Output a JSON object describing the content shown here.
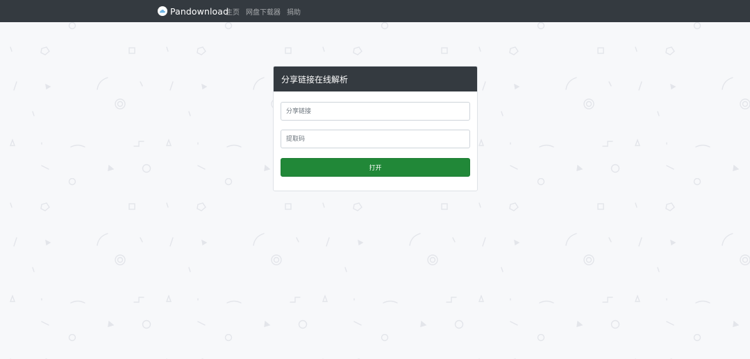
{
  "navbar": {
    "brand": "Pandownload",
    "brand_icon": "cloud-icon",
    "links": [
      "主页",
      "网盘下载器",
      "捐助"
    ]
  },
  "card": {
    "title": "分享链接在线解析",
    "link_placeholder": "分享链接",
    "code_placeholder": "提取码",
    "open_label": "打开"
  },
  "colors": {
    "navbar_bg": "#343a40",
    "page_bg": "#f7f8fa",
    "button_bg": "#218838"
  }
}
